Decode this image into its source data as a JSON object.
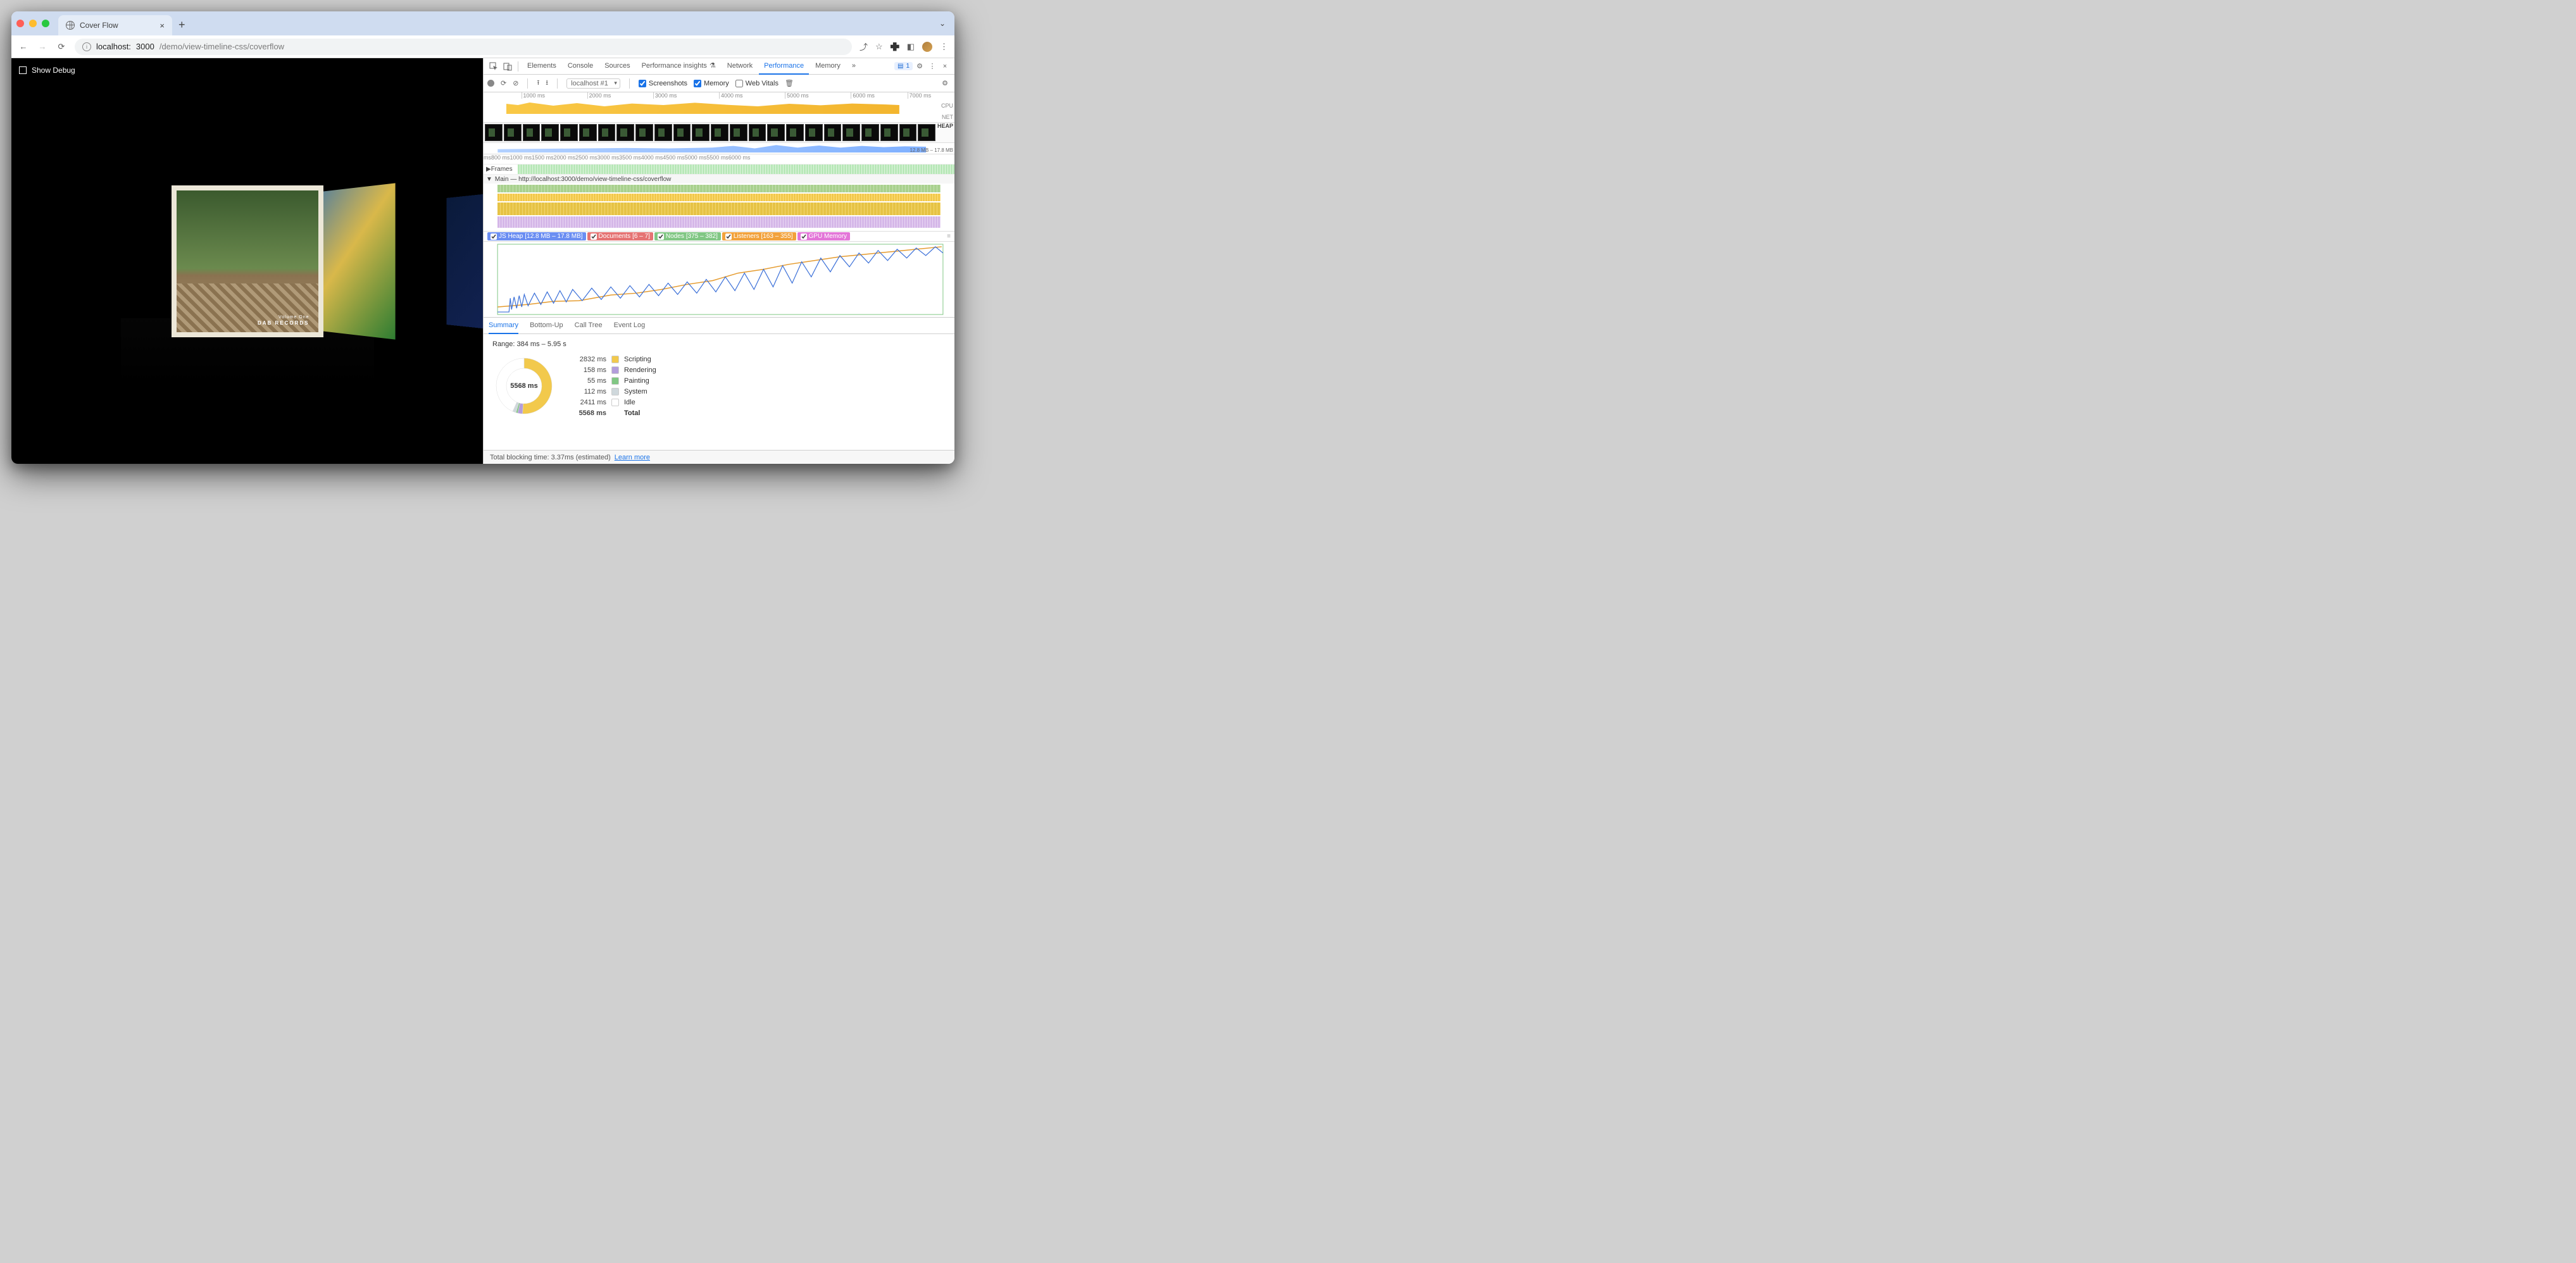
{
  "browser": {
    "tab_title": "Cover Flow",
    "url_host": "localhost:",
    "url_port": "3000",
    "url_path": "/demo/view-timeline-css/coverflow"
  },
  "page": {
    "debug_label": "Show Debug",
    "album_subtitle": "Volume One",
    "album_label": "DAB RECORDS"
  },
  "devtools": {
    "tabs": [
      "Elements",
      "Console",
      "Sources",
      "Performance insights",
      "Network",
      "Performance",
      "Memory"
    ],
    "active_tab": "Performance",
    "overflow": "»",
    "issues_count": "1",
    "record_context": "localhost #1",
    "checkboxes": {
      "screenshots": "Screenshots",
      "memory": "Memory",
      "webvitals": "Web Vitals"
    },
    "overview_ticks": [
      "1000 ms",
      "2000 ms",
      "3000 ms",
      "4000 ms",
      "5000 ms",
      "6000 ms",
      "7000 ms"
    ],
    "lane_cpu": "CPU",
    "lane_net": "NET",
    "lane_heap": "HEAP",
    "heap_range": "12.8 MB – 17.8 MB",
    "detail_ticks": [
      "ms",
      "800 ms",
      "1000 ms",
      "1500 ms",
      "2000 ms",
      "2500 ms",
      "3000 ms",
      "3500 ms",
      "4000 ms",
      "4500 ms",
      "5000 ms",
      "5500 ms",
      "6000 ms"
    ],
    "frames_label": "Frames",
    "main_label": "Main — http://localhost:3000/demo/view-timeline-css/coverflow",
    "counters": {
      "jsheap": {
        "label": "JS Heap",
        "range": "[12.8 MB – 17.8 MB]",
        "color": "#6b8ef2"
      },
      "documents": {
        "label": "Documents",
        "range": "[6 – 7]",
        "color": "#e57373"
      },
      "nodes": {
        "label": "Nodes",
        "range": "[375 – 382]",
        "color": "#81c784"
      },
      "listeners": {
        "label": "Listeners",
        "range": "[163 – 355]",
        "color": "#f2a23c"
      },
      "gpu": {
        "label": "GPU Memory",
        "range": "",
        "color": "#e376d8"
      }
    },
    "bottom_tabs": [
      "Summary",
      "Bottom-Up",
      "Call Tree",
      "Event Log"
    ],
    "active_bottom": "Summary",
    "range_text": "Range: 384 ms – 5.95 s"
  },
  "chart_data": {
    "type": "pie",
    "title": "Summary",
    "total_label": "5568 ms",
    "series": [
      {
        "name": "Scripting",
        "value": 2832,
        "unit": "ms",
        "color": "#f2c94c"
      },
      {
        "name": "Rendering",
        "value": 158,
        "unit": "ms",
        "color": "#b39ddb"
      },
      {
        "name": "Painting",
        "value": 55,
        "unit": "ms",
        "color": "#81c784"
      },
      {
        "name": "System",
        "value": 112,
        "unit": "ms",
        "color": "#cfd8dc"
      },
      {
        "name": "Idle",
        "value": 2411,
        "unit": "ms",
        "color": "#ffffff"
      }
    ],
    "total": {
      "name": "Total",
      "value": 5568,
      "unit": "ms"
    }
  },
  "footer": {
    "text": "Total blocking time: 3.37ms (estimated)",
    "link": "Learn more"
  }
}
